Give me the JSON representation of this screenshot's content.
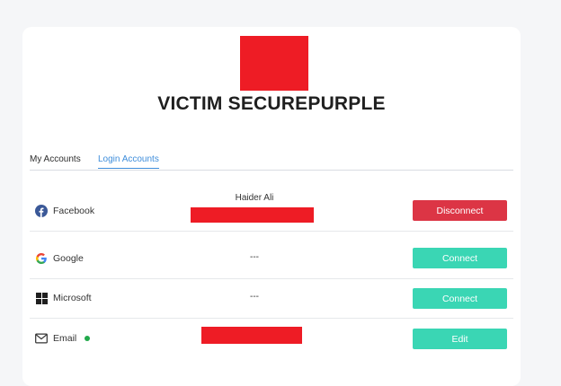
{
  "profile": {
    "title": "VICTIM SECUREPURPLE"
  },
  "tabs": [
    {
      "label": "My Accounts",
      "active": false
    },
    {
      "label": "Login Accounts",
      "active": true
    }
  ],
  "accounts": [
    {
      "provider": "Facebook",
      "icon": "facebook-icon",
      "detail": "Haider Ali",
      "detail_redacted": true,
      "action": "Disconnect"
    },
    {
      "provider": "Google",
      "icon": "google-icon",
      "detail": "---",
      "action": "Connect"
    },
    {
      "provider": "Microsoft",
      "icon": "microsoft-icon",
      "detail": "---",
      "action": "Connect"
    },
    {
      "provider": "Email",
      "icon": "envelope-icon",
      "detail_redacted": true,
      "verified": true,
      "action": "Edit"
    }
  ],
  "colors": {
    "accent": "#3e8ddb",
    "disconnect": "#dc3545",
    "connect": "#3ad6b4",
    "redaction": "#ee1c25",
    "verified_dot": "#22a94b"
  }
}
